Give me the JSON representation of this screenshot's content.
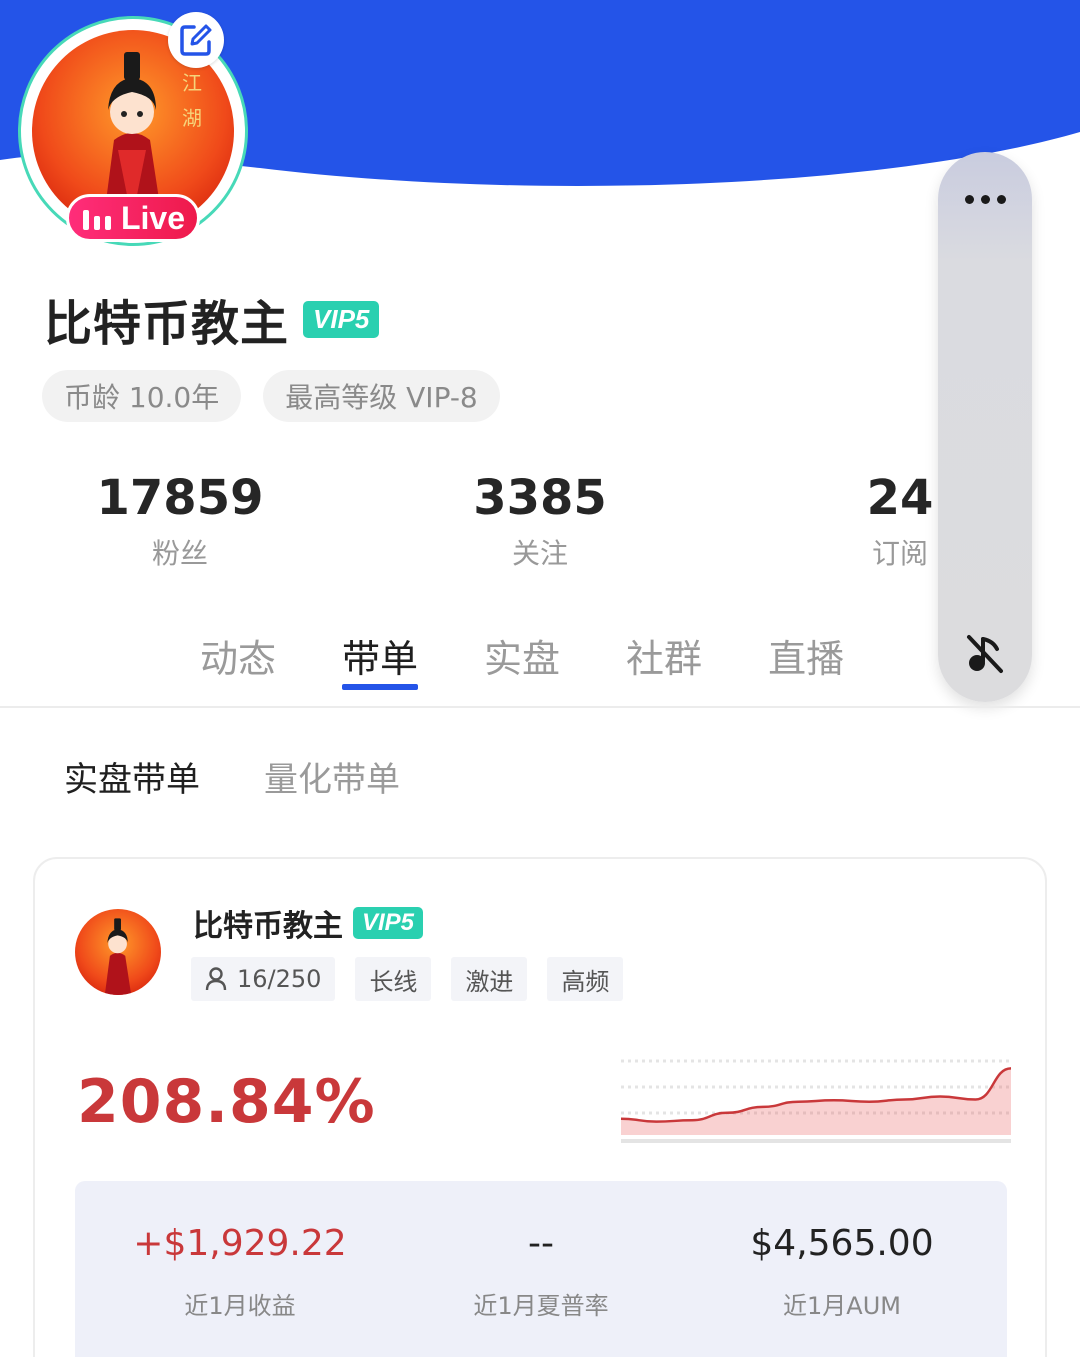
{
  "profile": {
    "name": "比特币教主",
    "vip_badge": "VIP5",
    "live_label": "Live",
    "tags": [
      "币龄 10.0年",
      "最高等级 VIP-8"
    ]
  },
  "stats": [
    {
      "value": "17859",
      "label": "粉丝"
    },
    {
      "value": "3385",
      "label": "关注"
    },
    {
      "value": "24",
      "label": "订阅"
    }
  ],
  "tabs": [
    {
      "label": "动态",
      "active": false
    },
    {
      "label": "带单",
      "active": true
    },
    {
      "label": "实盘",
      "active": false
    },
    {
      "label": "社群",
      "active": false
    },
    {
      "label": "直播",
      "active": false
    }
  ],
  "subtabs": [
    {
      "label": "实盘带单",
      "active": true
    },
    {
      "label": "量化带单",
      "active": false
    }
  ],
  "card": {
    "name": "比特币教主",
    "vip_badge": "VIP5",
    "followers_count": "16/250",
    "tags": [
      "长线",
      "激进",
      "高频"
    ],
    "roi": "208.84%",
    "metrics": [
      {
        "value": "+$1,929.22",
        "label": "近1月收益"
      },
      {
        "value": "--",
        "label": "近1月夏普率"
      },
      {
        "value": "$4,565.00",
        "label": "近1月AUM"
      }
    ]
  },
  "sparkline": [
    0.22,
    0.18,
    0.2,
    0.3,
    0.38,
    0.45,
    0.47,
    0.45,
    0.48,
    0.52,
    0.48,
    0.9
  ],
  "colors": {
    "brand_blue": "#2454e8",
    "vip_teal": "#2ad0b0",
    "profit_red": "#c9383a",
    "live_pink": "#ff2d7a"
  },
  "icons": [
    "edit-icon",
    "live-bars-icon",
    "more-icon",
    "mute-icon",
    "user-icon"
  ]
}
